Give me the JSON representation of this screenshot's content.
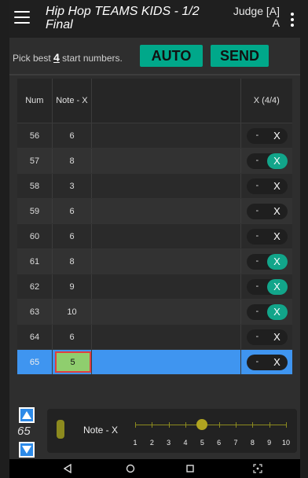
{
  "appbar": {
    "title_line1": "Hip Hop TEAMS KIDS - 1/2",
    "title_line2": "Final",
    "judge_line1": "Judge [A]",
    "judge_line2": "A"
  },
  "pick": {
    "prefix": "Pick best ",
    "count": "4",
    "suffix": " start numbers.",
    "auto_label": "AUTO",
    "send_label": "SEND"
  },
  "table": {
    "headers": {
      "num": "Num",
      "note": "Note - X",
      "x": "X (4/4)"
    },
    "rows": [
      {
        "num": "56",
        "note": "6",
        "minus": "-",
        "x": "X",
        "x_on": false
      },
      {
        "num": "57",
        "note": "8",
        "minus": "-",
        "x": "X",
        "x_on": true
      },
      {
        "num": "58",
        "note": "3",
        "minus": "-",
        "x": "X",
        "x_on": false
      },
      {
        "num": "59",
        "note": "6",
        "minus": "-",
        "x": "X",
        "x_on": false
      },
      {
        "num": "60",
        "note": "6",
        "minus": "-",
        "x": "X",
        "x_on": false
      },
      {
        "num": "61",
        "note": "8",
        "minus": "-",
        "x": "X",
        "x_on": true
      },
      {
        "num": "62",
        "note": "9",
        "minus": "-",
        "x": "X",
        "x_on": true
      },
      {
        "num": "63",
        "note": "10",
        "minus": "-",
        "x": "X",
        "x_on": true
      },
      {
        "num": "64",
        "note": "6",
        "minus": "-",
        "x": "X",
        "x_on": false
      },
      {
        "num": "65",
        "note": "5",
        "minus": "-",
        "x": "X",
        "x_on": false,
        "selected": true
      }
    ]
  },
  "bottom": {
    "current_number": "65",
    "slider_label": "Note - X",
    "slider_ticks": [
      "1",
      "2",
      "3",
      "4",
      "5",
      "6",
      "7",
      "8",
      "9",
      "10"
    ],
    "slider_value": 5,
    "slider_min": 1,
    "slider_max": 10
  },
  "icons": {
    "menu": "hamburger-menu-icon",
    "more": "more-vert-icon",
    "up": "arrow-up-icon",
    "down": "arrow-down-icon",
    "back": "nav-back-icon",
    "home": "nav-home-icon",
    "recents": "nav-recents-icon",
    "screenshot": "nav-screenshot-icon"
  },
  "colors": {
    "accent": "#00a88a",
    "selected_row": "#3f95f0",
    "slider": "#8c8a1e"
  }
}
